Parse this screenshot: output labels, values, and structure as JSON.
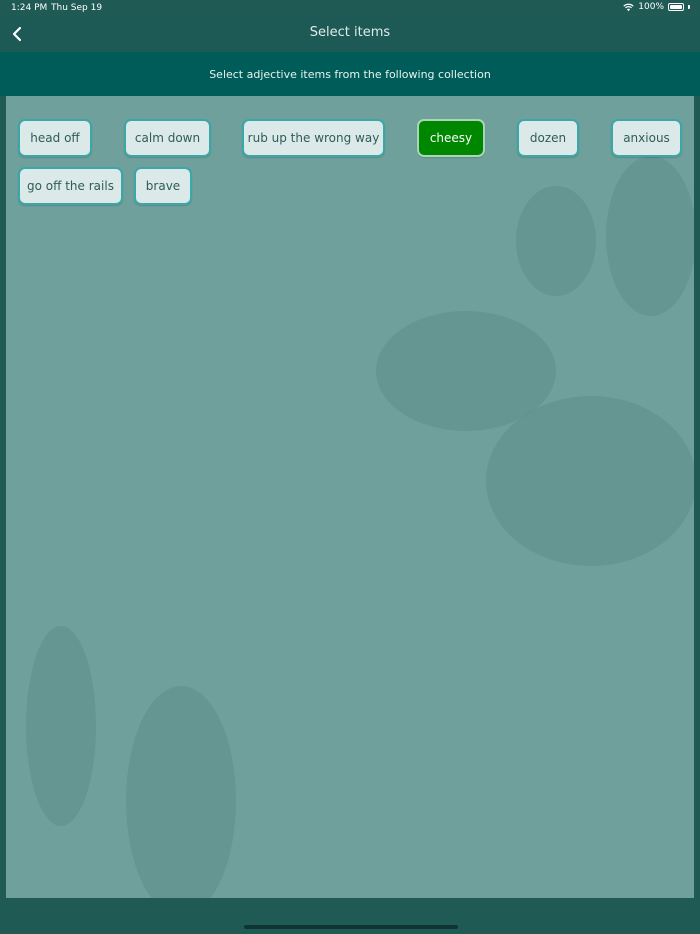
{
  "status_bar": {
    "time": "1:24 PM",
    "date": "Thu Sep 19",
    "battery": "100%"
  },
  "nav": {
    "title": "Select items",
    "back_icon": "chevron-left-icon"
  },
  "instruction": "Select adjective items from the following collection",
  "chips": [
    {
      "label": "head off",
      "selected": false
    },
    {
      "label": "calm down",
      "selected": false
    },
    {
      "label": "rub up the wrong way",
      "selected": false
    },
    {
      "label": "cheesy",
      "selected": true
    },
    {
      "label": "dozen",
      "selected": false
    },
    {
      "label": "anxious",
      "selected": false
    },
    {
      "label": "go off the rails",
      "selected": false
    },
    {
      "label": "brave",
      "selected": false
    }
  ],
  "colors": {
    "chip_selected": "#008700",
    "chip_default": "#dbe9e8",
    "chip_border": "#3aa7a8",
    "panel": "#6fa09c",
    "instruction_bar": "#005c58"
  }
}
